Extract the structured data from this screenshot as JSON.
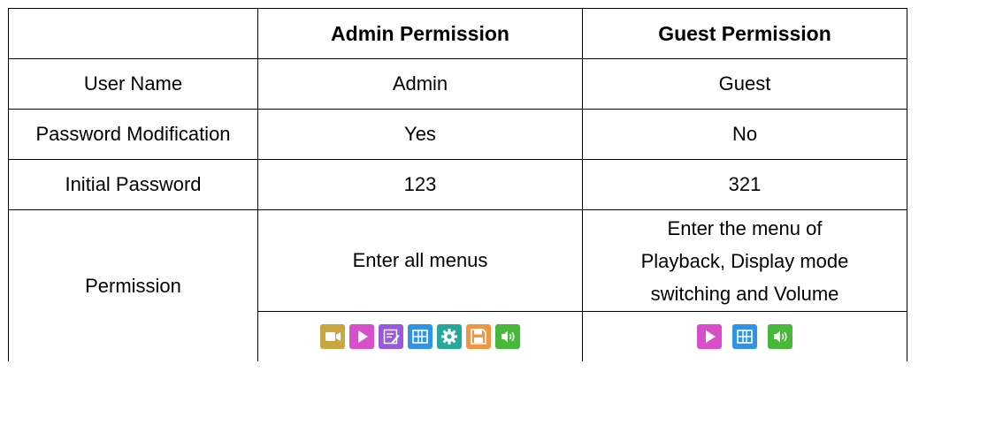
{
  "header": {
    "corner": "",
    "admin": "Admin Permission",
    "guest": "Guest Permission"
  },
  "rows": {
    "user_name": {
      "label": "User Name",
      "admin": "Admin",
      "guest": "Guest"
    },
    "password_modification": {
      "label": "Password Modification",
      "admin": "Yes",
      "guest": "No"
    },
    "initial_password": {
      "label": "Initial Password",
      "admin": "123",
      "guest": "321"
    },
    "permission": {
      "label": "Permission",
      "admin": "Enter all menus",
      "guest_lines": [
        "Enter the menu of",
        "Playback, Display mode",
        "switching and Volume"
      ]
    }
  },
  "icons": {
    "admin": [
      "video-icon",
      "play-icon",
      "notes-icon",
      "display-mode-icon",
      "settings-icon",
      "storage-icon",
      "volume-icon"
    ],
    "guest": [
      "play-icon",
      "display-mode-icon",
      "volume-icon"
    ]
  },
  "colors": {
    "video": "#c9a640",
    "play": "#d84fc9",
    "notes": "#9a57e0",
    "display": "#2f93e6",
    "settings": "#25a79a",
    "storage": "#f09642",
    "volume": "#47b83a"
  }
}
